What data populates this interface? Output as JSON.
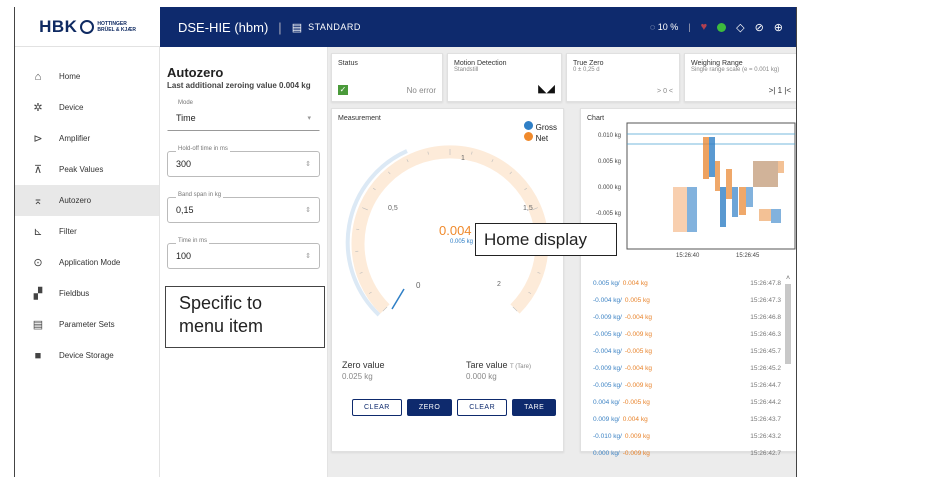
{
  "brand": {
    "logo": "HBK",
    "sub1": "HOTTINGER",
    "sub2": "BRÜEL & KJÆR"
  },
  "header": {
    "device": "DSE-HIE (hbm)",
    "mode_icon": "book-icon",
    "mode": "STANDARD",
    "progress": "10 %",
    "heart_color": "#b04050",
    "status_color": "#3dbb3d"
  },
  "sidebar": {
    "items": [
      {
        "label": "Home",
        "icon": "home-icon",
        "glyph": "⌂"
      },
      {
        "label": "Device",
        "icon": "gear-icon",
        "glyph": "✲"
      },
      {
        "label": "Amplifier",
        "icon": "amplifier-icon",
        "glyph": "⊳"
      },
      {
        "label": "Peak Values",
        "icon": "peak-icon",
        "glyph": "⊼"
      },
      {
        "label": "Autozero",
        "icon": "autozero-icon",
        "glyph": "⌅"
      },
      {
        "label": "Filter",
        "icon": "filter-icon",
        "glyph": "⊾"
      },
      {
        "label": "Application Mode",
        "icon": "application-icon",
        "glyph": "⊙"
      },
      {
        "label": "Fieldbus",
        "icon": "fieldbus-icon",
        "glyph": "▞"
      },
      {
        "label": "Parameter Sets",
        "icon": "parameter-icon",
        "glyph": "▤"
      },
      {
        "label": "Device Storage",
        "icon": "folder-icon",
        "glyph": "■"
      }
    ]
  },
  "panel": {
    "title": "Autozero",
    "description": "Last additional zeroing value 0.004 kg",
    "mode": {
      "label": "Mode",
      "value": "Time"
    },
    "hold": {
      "label": "Hold-off time in ms",
      "value": "300"
    },
    "band": {
      "label": "Band span in kg",
      "value": "0,15"
    },
    "time": {
      "label": "Time in ms",
      "value": "100"
    }
  },
  "callout_menu": {
    "line1": "Specific to",
    "line2": "menu item"
  },
  "callout_home": "Home display",
  "status": {
    "title": "Status",
    "value": "No error"
  },
  "motion": {
    "title": "Motion Detection",
    "value": "Standstill"
  },
  "truezero": {
    "title": "True Zero",
    "sub": "0 ± 0,25 d",
    "value": "> 0 <"
  },
  "range": {
    "title": "Weighing Range",
    "sub": "Single range scale (e = 0.001 kg)",
    "value": ">| 1 |<"
  },
  "measurement": {
    "title": "Measurement",
    "legend": [
      "Gross",
      "Net"
    ],
    "value": "0.004 kg",
    "gross": "0.005 kg",
    "scale": [
      "0",
      "0,5",
      "1",
      "1,5",
      "2"
    ],
    "zero_label": "Zero value",
    "zero_value": "0.025 kg",
    "tare_label": "Tare value",
    "tare_sub": "T (Tare)",
    "tare_value": "0.000 kg",
    "buttons": [
      "CLEAR",
      "ZERO",
      "CLEAR",
      "TARE"
    ]
  },
  "chart": {
    "title": "Chart",
    "yticks": [
      "0.010 kg",
      "0.005 kg",
      "0.000 kg",
      "-0.005 kg"
    ],
    "xticks": [
      "15:26:40",
      "15:26:45"
    ]
  },
  "log": [
    {
      "g": "0.005 kg/",
      "n": "0.004 kg",
      "t": "15:26:47.8"
    },
    {
      "g": "-0.004 kg/",
      "n": "0.005 kg",
      "t": "15:26:47.3"
    },
    {
      "g": "-0.009 kg/",
      "n": "-0.004 kg",
      "t": "15:26:46.8"
    },
    {
      "g": "-0.005 kg/",
      "n": "-0.009 kg",
      "t": "15:26:46.3"
    },
    {
      "g": "-0.004 kg/",
      "n": "-0.005 kg",
      "t": "15:26:45.7"
    },
    {
      "g": "-0.009 kg/",
      "n": "-0.004 kg",
      "t": "15:26:45.2"
    },
    {
      "g": "-0.005 kg/",
      "n": "-0.009 kg",
      "t": "15:26:44.7"
    },
    {
      "g": "0.004 kg/",
      "n": "-0.005 kg",
      "t": "15:26:44.2"
    },
    {
      "g": "0.009 kg/",
      "n": "0.004 kg",
      "t": "15:26:43.7"
    },
    {
      "g": "-0.010 kg/",
      "n": "0.009 kg",
      "t": "15:26:43.2"
    },
    {
      "g": "0.000 kg/",
      "n": "-0.009 kg",
      "t": "15:26:42.7"
    }
  ],
  "colors": {
    "navy": "#0e2a6d",
    "gross": "#2f7fc6",
    "net": "#f08a2c"
  }
}
